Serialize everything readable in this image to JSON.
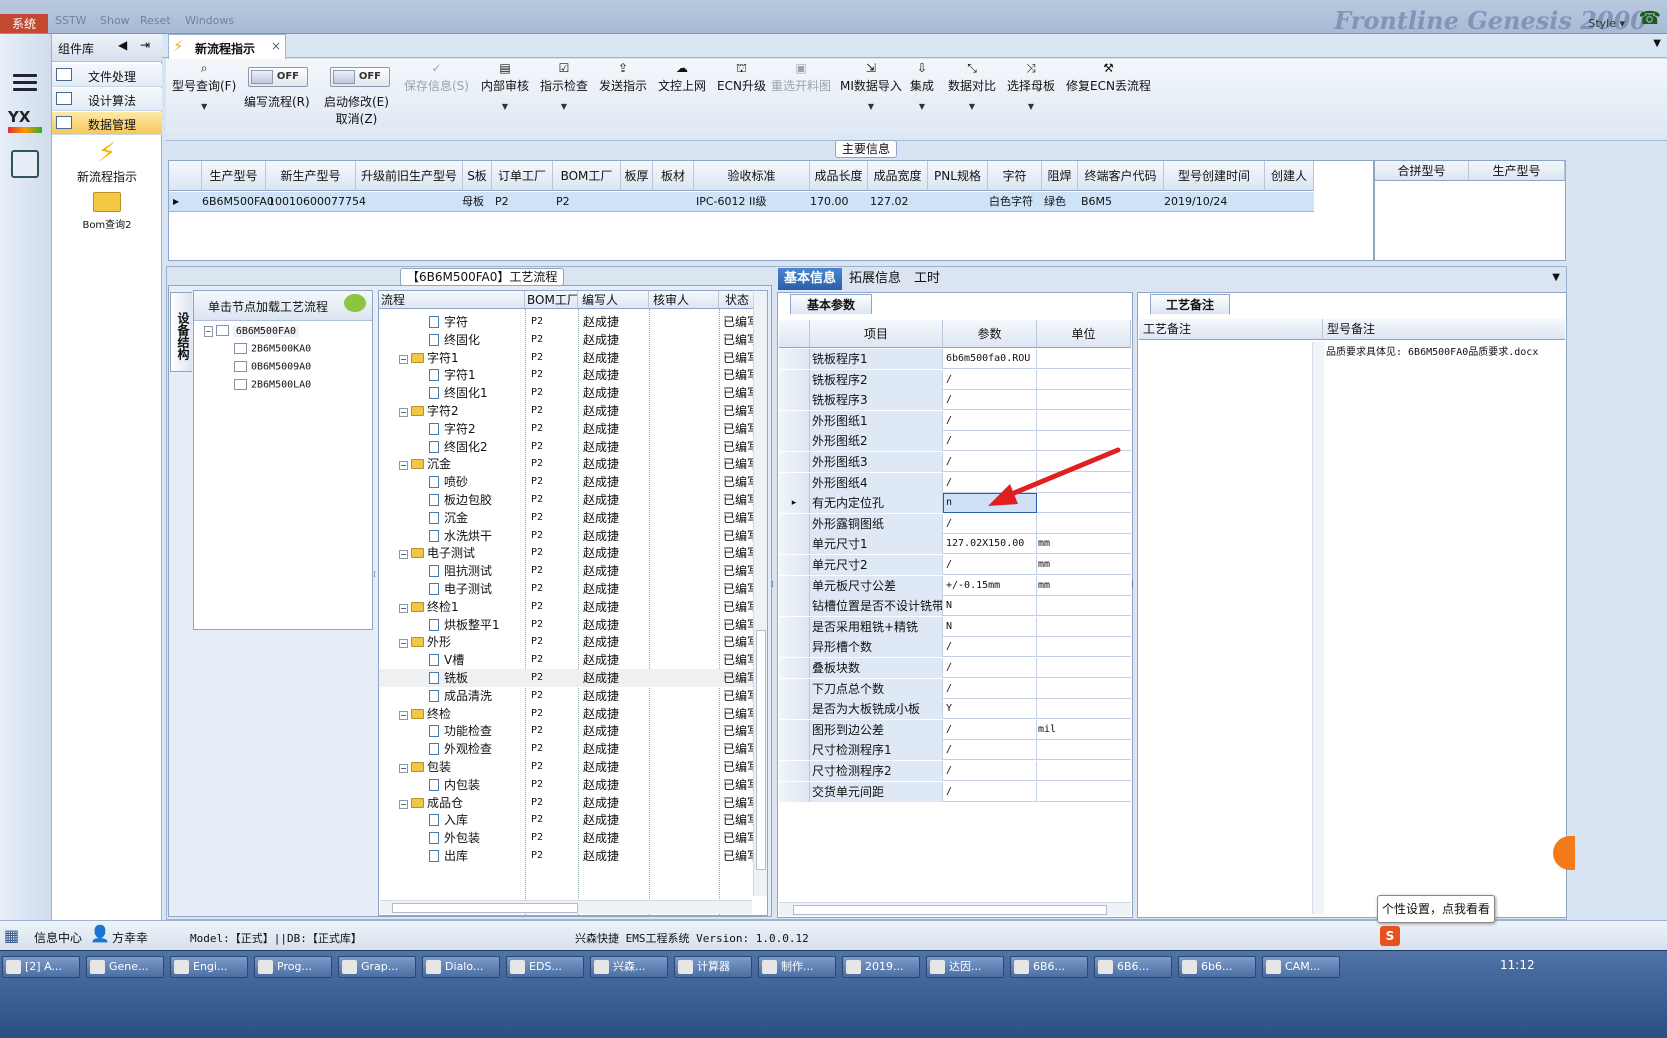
{
  "topbar": {
    "system_btn": "系统",
    "faint_menu": [
      "SSTW",
      "Show",
      "Reset",
      "Windows"
    ],
    "brand": "Frontline Genesis 2000",
    "style_label": "Style ▾"
  },
  "component_panel": {
    "title": "组件库",
    "items": [
      {
        "label": "文件处理"
      },
      {
        "label": "设计算法"
      },
      {
        "label": "数据管理"
      }
    ],
    "launch_items": [
      {
        "label": "新流程指示"
      },
      {
        "label": "Bom查询2"
      }
    ]
  },
  "main_tab": {
    "label": "新流程指示",
    "close": "×"
  },
  "toolbar": {
    "buttons": [
      {
        "label": "型号查询(F)",
        "icon": "search-icon",
        "dropdown": true,
        "disabled": false
      },
      {
        "label": "编写流程(R)",
        "toggle": "OFF"
      },
      {
        "label": "启动修改(E)",
        "label2": "取消(Z)",
        "toggle": "OFF"
      },
      {
        "label": "保存信息(S)",
        "icon": "check-icon",
        "disabled": true
      },
      {
        "label": "内部审核",
        "icon": "printer-icon",
        "dropdown": true
      },
      {
        "label": "指示检查",
        "icon": "checkbox-icon",
        "dropdown": true
      },
      {
        "label": "发送指示",
        "icon": "upload-icon"
      },
      {
        "label": "文控上网",
        "icon": "cloud-upload-icon"
      },
      {
        "label": "ECN升级",
        "icon": "ecn-icon"
      },
      {
        "label": "重选开料图",
        "icon": "image-icon",
        "disabled": true
      },
      {
        "label": "MI数据导入",
        "icon": "import-icon",
        "dropdown": true
      },
      {
        "label": "集成",
        "icon": "download-icon",
        "dropdown": true
      },
      {
        "label": "数据对比",
        "icon": "compare-icon",
        "dropdown": true
      },
      {
        "label": "选择母板",
        "icon": "shuffle-icon",
        "dropdown": true
      },
      {
        "label": "修复ECN丢流程",
        "icon": "wrench-icon"
      }
    ]
  },
  "main_info": {
    "legend": "主要信息",
    "columns": [
      "生产型号",
      "新生产型号",
      "升级前旧生产型号",
      "S板",
      "订单工厂",
      "BOM工厂",
      "板厚",
      "板材",
      "验收标准",
      "成品长度",
      "成品宽度",
      "PNL规格",
      "字符",
      "阻焊",
      "终端客户代码",
      "型号创建时间",
      "创建人"
    ],
    "row": [
      "6B6M500FA0",
      "10010600077754",
      "",
      "母板",
      "P2",
      "P2",
      "",
      "",
      "IPC-6012 II级",
      "170.00",
      "127.02",
      "",
      "白色字符",
      "绿色",
      "B6M5",
      "2019/10/24",
      ""
    ],
    "merge_columns": [
      "合拼型号",
      "生产型号"
    ]
  },
  "process": {
    "legend": "【6B6M500FA0】工艺流程",
    "side_tab": "设备结构",
    "tree_hint": "单击节点加载工艺流程",
    "tree": {
      "root": "6B6M500FA0",
      "children": [
        "2B6M500KA0",
        "0B6M5009A0",
        "2B6M500LA0"
      ]
    },
    "grid_columns": [
      "流程",
      "BOM工厂",
      "编写人",
      "核审人",
      "状态"
    ],
    "rows": [
      {
        "level": 1,
        "name": "字符",
        "bom": "P2",
        "writer": "赵成捷",
        "status": "已编写"
      },
      {
        "level": 1,
        "name": "终固化",
        "bom": "P2",
        "writer": "赵成捷",
        "status": "已编写"
      },
      {
        "level": 0,
        "name": "字符1",
        "bom": "P2",
        "writer": "赵成捷",
        "status": "已编写"
      },
      {
        "level": 1,
        "name": "字符1",
        "bom": "P2",
        "writer": "赵成捷",
        "status": "已编写"
      },
      {
        "level": 1,
        "name": "终固化1",
        "bom": "P2",
        "writer": "赵成捷",
        "status": "已编写"
      },
      {
        "level": 0,
        "name": "字符2",
        "bom": "P2",
        "writer": "赵成捷",
        "status": "已编写"
      },
      {
        "level": 1,
        "name": "字符2",
        "bom": "P2",
        "writer": "赵成捷",
        "status": "已编写"
      },
      {
        "level": 1,
        "name": "终固化2",
        "bom": "P2",
        "writer": "赵成捷",
        "status": "已编写"
      },
      {
        "level": 0,
        "name": "沉金",
        "bom": "P2",
        "writer": "赵成捷",
        "status": "已编写"
      },
      {
        "level": 1,
        "name": "喷砂",
        "bom": "P2",
        "writer": "赵成捷",
        "status": "已编写"
      },
      {
        "level": 1,
        "name": "板边包胶",
        "bom": "P2",
        "writer": "赵成捷",
        "status": "已编写"
      },
      {
        "level": 1,
        "name": "沉金",
        "bom": "P2",
        "writer": "赵成捷",
        "status": "已编写"
      },
      {
        "level": 1,
        "name": "水洗烘干",
        "bom": "P2",
        "writer": "赵成捷",
        "status": "已编写"
      },
      {
        "level": 0,
        "name": "电子测试",
        "bom": "P2",
        "writer": "赵成捷",
        "status": "已编写"
      },
      {
        "level": 1,
        "name": "阻抗测试",
        "bom": "P2",
        "writer": "赵成捷",
        "status": "已编写"
      },
      {
        "level": 1,
        "name": "电子测试",
        "bom": "P2",
        "writer": "赵成捷",
        "status": "已编写"
      },
      {
        "level": 0,
        "name": "终检1",
        "bom": "P2",
        "writer": "赵成捷",
        "status": "已编写"
      },
      {
        "level": 1,
        "name": "烘板整平1",
        "bom": "P2",
        "writer": "赵成捷",
        "status": "已编写"
      },
      {
        "level": 0,
        "name": "外形",
        "bom": "P2",
        "writer": "赵成捷",
        "status": "已编写"
      },
      {
        "level": 1,
        "name": "V槽",
        "bom": "P2",
        "writer": "赵成捷",
        "status": "已编写"
      },
      {
        "level": 1,
        "name": "铣板",
        "bom": "P2",
        "writer": "赵成捷",
        "status": "已编写",
        "selected": true
      },
      {
        "level": 1,
        "name": "成品清洗",
        "bom": "P2",
        "writer": "赵成捷",
        "status": "已编写"
      },
      {
        "level": 0,
        "name": "终检",
        "bom": "P2",
        "writer": "赵成捷",
        "status": "已编写"
      },
      {
        "level": 1,
        "name": "功能检查",
        "bom": "P2",
        "writer": "赵成捷",
        "status": "已编写"
      },
      {
        "level": 1,
        "name": "外观检查",
        "bom": "P2",
        "writer": "赵成捷",
        "status": "已编写"
      },
      {
        "level": 0,
        "name": "包装",
        "bom": "P2",
        "writer": "赵成捷",
        "status": "已编写"
      },
      {
        "level": 1,
        "name": "内包装",
        "bom": "P2",
        "writer": "赵成捷",
        "status": "已编写"
      },
      {
        "level": 0,
        "name": "成品仓",
        "bom": "P2",
        "writer": "赵成捷",
        "status": "已编写"
      },
      {
        "level": 1,
        "name": "入库",
        "bom": "P2",
        "writer": "赵成捷",
        "status": "已编写"
      },
      {
        "level": 1,
        "name": "外包装",
        "bom": "P2",
        "writer": "赵成捷",
        "status": "已编写"
      },
      {
        "level": 1,
        "name": "出库",
        "bom": "P2",
        "writer": "赵成捷",
        "status": "已编写"
      }
    ]
  },
  "right_tabs": [
    "基本信息",
    "拓展信息",
    "工时"
  ],
  "basic_params": {
    "tab": "基本参数",
    "columns": [
      "项目",
      "参数",
      "单位"
    ],
    "rows": [
      {
        "item": "铣板程序1",
        "value": "6b6m500fa0.ROU",
        "unit": ""
      },
      {
        "item": "铣板程序2",
        "value": "/",
        "unit": ""
      },
      {
        "item": "铣板程序3",
        "value": "/",
        "unit": ""
      },
      {
        "item": "外形图纸1",
        "value": "/",
        "unit": ""
      },
      {
        "item": "外形图纸2",
        "value": "/",
        "unit": ""
      },
      {
        "item": "外形图纸3",
        "value": "/",
        "unit": ""
      },
      {
        "item": "外形图纸4",
        "value": "/",
        "unit": ""
      },
      {
        "item": "有无内定位孔",
        "value": "n",
        "unit": "",
        "editing": true
      },
      {
        "item": "外形露铜图纸",
        "value": "/",
        "unit": ""
      },
      {
        "item": "单元尺寸1",
        "value": "127.02X150.00",
        "unit": "mm"
      },
      {
        "item": "单元尺寸2",
        "value": "/",
        "unit": "mm"
      },
      {
        "item": "单元板尺寸公差",
        "value": "+/-0.15mm",
        "unit": "mm"
      },
      {
        "item": "钻槽位置是否不设计铣带",
        "value": "N",
        "unit": ""
      },
      {
        "item": "是否采用粗铣+精铣",
        "value": "N",
        "unit": ""
      },
      {
        "item": "异形槽个数",
        "value": "/",
        "unit": ""
      },
      {
        "item": "叠板块数",
        "value": "/",
        "unit": ""
      },
      {
        "item": "下刀点总个数",
        "value": "/",
        "unit": ""
      },
      {
        "item": "是否为大板铣成小板",
        "value": "Y",
        "unit": ""
      },
      {
        "item": "图形到边公差",
        "value": "/",
        "unit": "mil"
      },
      {
        "item": "尺寸检测程序1",
        "value": "/",
        "unit": ""
      },
      {
        "item": "尺寸检测程序2",
        "value": "/",
        "unit": ""
      },
      {
        "item": "交货单元间距",
        "value": "/",
        "unit": ""
      }
    ]
  },
  "process_remarks": {
    "tab": "工艺备注",
    "columns": [
      "工艺备注",
      "型号备注"
    ],
    "model_remark": "品质要求具体见: 6B6M500FA0品质要求.docx"
  },
  "statusbar": {
    "info_center": "信息中心",
    "user": "方幸幸",
    "model_db": "Model:【正式】||DB:【正式库】",
    "version": "兴森快捷 EMS工程系统 Version: 1.0.0.12",
    "tooltip": "个性设置，点我看看"
  },
  "taskbar": {
    "items": [
      "[2] A...",
      "Gene...",
      "Engi...",
      "Prog...",
      "Grap...",
      "Dialo...",
      "EDS...",
      "兴森...",
      "计算器",
      "制作...",
      "2019...",
      "达因...",
      "6B6...",
      "6B6...",
      "6b6...",
      "CAM..."
    ],
    "clock": "11:12"
  }
}
